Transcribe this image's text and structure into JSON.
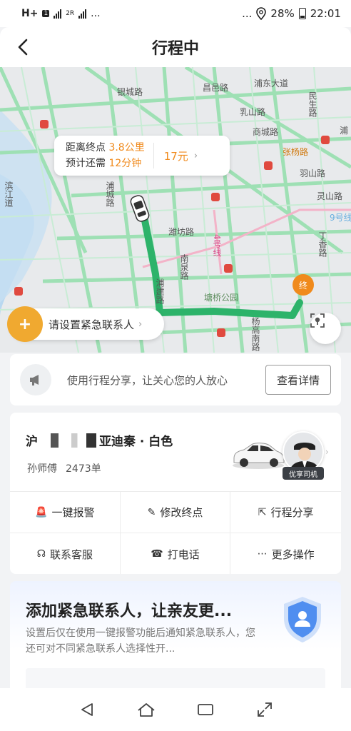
{
  "status_bar": {
    "network": "H+",
    "sim1": "1",
    "sim2": "2R",
    "dots_left": "...",
    "dots_right": "...",
    "battery": "28%",
    "time": "22:01"
  },
  "header": {
    "title": "行程中"
  },
  "map": {
    "labels": {
      "yinchenglu": "银城路",
      "changyilu": "昌邑路",
      "pudongdadao": "浦东大道",
      "minshenglu": "民生路",
      "rushanlu": "乳山路",
      "shangchenglu": "商城路",
      "zhangyanglu": "张杨路",
      "pucheng": "浦城路",
      "weifanglu": "潍坊路",
      "nanquan": "南泉路",
      "pujian": "浦建路",
      "tangqiao": "塘桥公园",
      "yanggao": "杨高南路",
      "dingxiang": "丁香路",
      "yushan": "羽山路",
      "lingshan": "灵山路",
      "hui": "浦",
      "bin": "滨江道",
      "line9": "9号线",
      "line4": "4号线"
    },
    "info": {
      "distance_prefix": "距离终点",
      "distance_value": "3.8公里",
      "time_prefix": "预计还需",
      "time_value": "12分钟",
      "fare": "17元"
    },
    "emergency_pill": "请设置紧急联系人",
    "dest_marker": "终"
  },
  "share_banner": {
    "text": "使用行程分享，让关心您的人放心",
    "button": "查看详情"
  },
  "driver": {
    "plate_prefix": "沪",
    "plate_suffix": "亚迪秦 · 白色",
    "name": "孙师傅",
    "orders": "2473单",
    "badge": "优享司机"
  },
  "actions": [
    {
      "label": "一键报警",
      "icon": "alarm-icon",
      "color": "#e5352b"
    },
    {
      "label": "修改终点",
      "icon": "pencil-icon",
      "color": "#333333"
    },
    {
      "label": "行程分享",
      "icon": "share-icon",
      "color": "#333333"
    },
    {
      "label": "联系客服",
      "icon": "headset-icon",
      "color": "#333333"
    },
    {
      "label": "打电话",
      "icon": "phone-icon",
      "color": "#333333"
    },
    {
      "label": "更多操作",
      "icon": "more-icon",
      "color": "#333333"
    }
  ],
  "contact_card": {
    "title": "添加紧急联系人，让亲友更...",
    "desc": "设置后仅在使用一键报警功能后通知紧急联系人，您还可对不同紧急联系人选择性开..."
  },
  "colors": {
    "route": "#2db36a",
    "accent": "#f08a1c",
    "road": "#8fd9a8"
  }
}
